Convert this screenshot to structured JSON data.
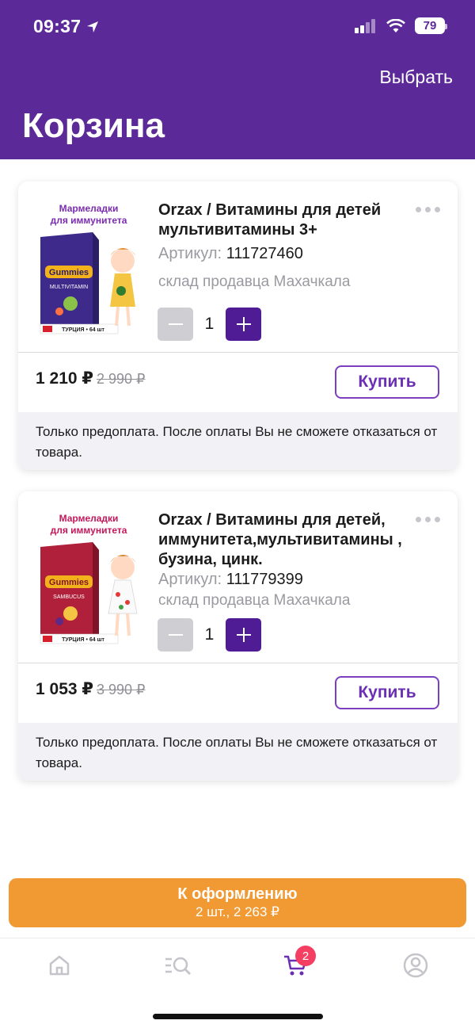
{
  "status_bar": {
    "time": "09:37",
    "battery": "79"
  },
  "header": {
    "select_label": "Выбрать",
    "title": "Корзина"
  },
  "items": [
    {
      "image_title": "Мармеладки для иммунитета",
      "image_flag_label": "ТУРЦИЯ • 64 шт",
      "image_brand": "Gummies",
      "image_sub": "MULTIVITAMIN",
      "title": "Orzax / Витамины для детей мультивитамины 3+",
      "sku_label": "Артикул:",
      "sku": "111727460",
      "store": "склад продавца Махачкала",
      "qty": "1",
      "price": "1 210 ₽",
      "old_price": "2 990 ₽",
      "buy_label": "Купить",
      "notice": "Только предоплата. После оплаты Вы не сможете отказаться от товара."
    },
    {
      "image_title": "Мармеладки для иммунитета",
      "image_flag_label": "ТУРЦИЯ • 64 шт",
      "image_brand": "Gummies",
      "image_sub": "SAMBUCUS",
      "title": "Orzax / Витамины для детей, иммунитета,мультивитамины , бузина, цинк.",
      "sku_label": "Артикул:",
      "sku": "111779399",
      "store": "склад продавца Махачкала",
      "qty": "1",
      "price": "1 053 ₽",
      "old_price": "3 990 ₽",
      "buy_label": "Купить",
      "notice": "Только предоплата. После оплаты Вы не сможете отказаться от товара."
    }
  ],
  "checkout": {
    "label": "К оформлению",
    "summary": "2 шт., 2 263 ₽"
  },
  "tabbar": {
    "tabs": [
      {
        "icon": "home-icon"
      },
      {
        "icon": "catalog-search-icon"
      },
      {
        "icon": "cart-icon",
        "badge": "2"
      },
      {
        "icon": "profile-icon"
      }
    ]
  },
  "colors": {
    "brand": "#5c2a98",
    "accent": "#f19a33",
    "badge": "#f43f62"
  }
}
